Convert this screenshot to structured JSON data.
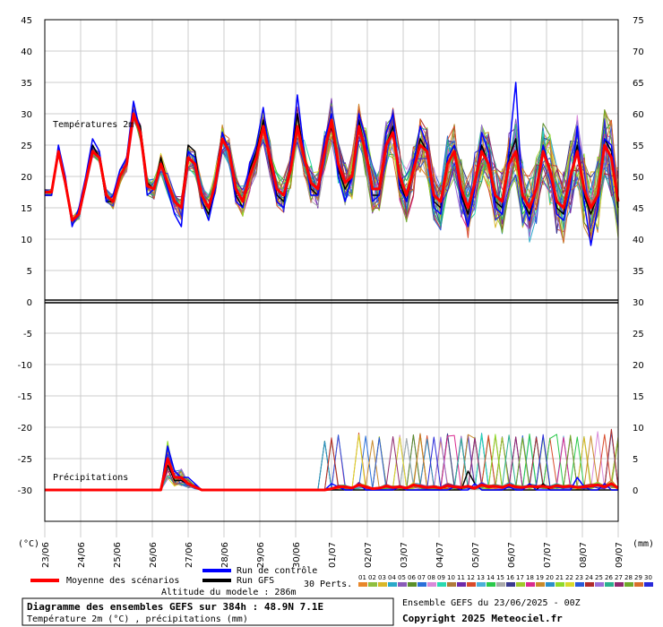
{
  "chart_data": {
    "type": "line",
    "title": "Diagramme des ensembles GEFS sur 384h : 48.9N 7.1E",
    "subtitle": "Température 2m (°C) , précipitations (mm)",
    "temp_label": "Températures 2m",
    "precip_label": "Précipitations",
    "left_unit": "(°C)",
    "right_unit": "(mm)",
    "left_ticks": [
      "45",
      "40",
      "35",
      "30",
      "25",
      "20",
      "15",
      "10",
      "5",
      "0",
      "-5",
      "-10",
      "-15",
      "-20",
      "-25",
      "-30"
    ],
    "right_ticks": [
      "75",
      "70",
      "65",
      "60",
      "55",
      "50",
      "45",
      "40",
      "35",
      "30",
      "25",
      "20",
      "15",
      "10",
      "5",
      "0"
    ],
    "x_dates": [
      "23/06",
      "24/06",
      "25/06",
      "26/06",
      "27/06",
      "28/06",
      "29/06",
      "30/06",
      "01/07",
      "02/07",
      "03/07",
      "04/07",
      "05/07",
      "06/07",
      "07/07",
      "08/07",
      "09/07"
    ],
    "temp_mean": [
      17.5,
      17.5,
      24,
      19,
      13,
      14,
      19,
      24,
      23,
      17,
      16,
      20,
      22,
      30,
      27,
      18.5,
      18,
      22,
      19,
      16,
      15,
      23,
      22,
      17,
      15,
      19,
      26,
      24,
      18,
      16,
      20,
      23,
      28,
      23,
      18,
      17,
      21,
      28,
      23,
      19,
      18,
      24,
      29,
      22,
      19,
      20,
      28,
      24,
      18,
      18,
      25,
      27,
      20,
      17,
      21,
      25,
      24,
      17,
      16,
      22,
      24,
      18,
      15,
      19,
      24,
      22,
      17,
      16,
      22,
      24,
      17,
      15,
      18,
      24,
      21,
      16,
      15,
      20,
      24,
      18,
      15,
      17,
      25,
      23,
      16
    ],
    "temp_control": [
      17,
      17,
      25,
      20,
      12,
      15,
      20,
      26,
      24,
      16,
      17,
      21,
      23,
      32,
      27,
      17,
      18,
      22,
      18,
      14,
      12,
      24,
      23,
      16,
      13,
      18,
      27,
      24,
      16,
      15,
      22,
      25,
      31,
      23,
      16,
      15,
      22,
      33,
      24,
      17,
      17,
      26,
      30,
      20,
      16,
      20,
      30,
      26,
      16,
      17,
      27,
      30,
      18,
      16,
      22,
      28,
      25,
      15,
      14,
      23,
      25,
      16,
      12,
      18,
      27,
      24,
      15,
      14,
      24,
      35,
      16,
      13,
      18,
      25,
      21,
      14,
      13,
      18,
      28,
      16,
      9,
      15,
      26,
      25,
      16
    ],
    "temp_gfs": [
      17,
      17,
      24,
      19,
      13,
      14,
      19,
      25,
      23,
      16,
      16,
      20,
      22,
      30,
      28,
      19,
      18,
      23,
      19,
      16,
      15,
      25,
      24,
      16,
      14,
      19,
      27,
      24,
      17,
      15,
      21,
      24,
      29,
      22,
      17,
      16,
      22,
      30,
      23,
      18,
      17,
      24,
      28,
      21,
      18,
      20,
      29,
      24,
      17,
      17,
      25,
      28,
      19,
      16,
      21,
      26,
      24,
      16,
      15,
      23,
      25,
      17,
      14,
      19,
      25,
      22,
      16,
      15,
      23,
      26,
      16,
      14,
      18,
      25,
      21,
      15,
      14,
      20,
      25,
      17,
      14,
      17,
      26,
      24,
      15
    ],
    "precip_mean": [
      0,
      0,
      0,
      0,
      0,
      0,
      0,
      0,
      0,
      0,
      0,
      0,
      0,
      0,
      0,
      0,
      0,
      0,
      5,
      2,
      2,
      1,
      0.5,
      0,
      0,
      0,
      0,
      0,
      0,
      0,
      0,
      0,
      0,
      0,
      0,
      0,
      0,
      0,
      0,
      0,
      0,
      0,
      0.2,
      0.5,
      0.5,
      0.3,
      0.8,
      0.5,
      0.2,
      0.3,
      0.6,
      0.4,
      0.5,
      0.3,
      0.8,
      0.6,
      0.4,
      0.5,
      0.3,
      0.7,
      0.5,
      0.4,
      0.6,
      0.3,
      0.8,
      0.5,
      0.6,
      0.4,
      0.8,
      0.5,
      0.4,
      0.6,
      0.5,
      0.6,
      0.4,
      0.7,
      0.5,
      0.6,
      0.4,
      0.5,
      0.6,
      0.8,
      0.5,
      1,
      0.3
    ],
    "precip_control": [
      0,
      0,
      0,
      0,
      0,
      0,
      0,
      0,
      0,
      0,
      0,
      0,
      0,
      0,
      0,
      0,
      0,
      0,
      7,
      3,
      2,
      2,
      1,
      0,
      0,
      0,
      0,
      0,
      0,
      0,
      0,
      0,
      0,
      0,
      0,
      0,
      0,
      0,
      0,
      0,
      0,
      0,
      1,
      0.5,
      0,
      0,
      1,
      0,
      0,
      0,
      0,
      0,
      0.5,
      0,
      0,
      0,
      0,
      0,
      0,
      0,
      0.5,
      0,
      0,
      1,
      0,
      0,
      0,
      0,
      0.5,
      0,
      0,
      1,
      0,
      0,
      0,
      0,
      0,
      0,
      2,
      0.5,
      0,
      0,
      1,
      0,
      0
    ],
    "precip_gfs": [
      0,
      0,
      0,
      0,
      0,
      0,
      0,
      0,
      0,
      0,
      0,
      0,
      0,
      0,
      0,
      0,
      0,
      0,
      4,
      1.5,
      1.5,
      1,
      0.5,
      0,
      0,
      0,
      0,
      0,
      0,
      0,
      0,
      0,
      0,
      0,
      0,
      0,
      0,
      0,
      0,
      0,
      0,
      0,
      0,
      0,
      0,
      0,
      0,
      0,
      0,
      0,
      0,
      0,
      0,
      0,
      0,
      0,
      0,
      0,
      0,
      0,
      0,
      0,
      3,
      1,
      0,
      0,
      0,
      0,
      0,
      0,
      0,
      0,
      0,
      1,
      0,
      0,
      0,
      0,
      0,
      0,
      0,
      0,
      0,
      0,
      0
    ],
    "temp_y_range": [
      -30,
      45
    ],
    "precip_y_range": [
      0,
      75
    ]
  },
  "legend": {
    "mean": "Moyenne des scénarios",
    "control": "Run de contrôle",
    "gfs": "Run GFS",
    "perts_label": "30 Perts.",
    "altitude": "Altitude du modele : 286m",
    "perts": [
      "01",
      "02",
      "03",
      "04",
      "05",
      "06",
      "07",
      "08",
      "09",
      "10",
      "11",
      "12",
      "13",
      "14",
      "15",
      "16",
      "17",
      "18",
      "19",
      "20",
      "21",
      "22",
      "23",
      "24",
      "25",
      "26",
      "27",
      "28",
      "29",
      "30"
    ],
    "pert_colors": [
      "#e8872a",
      "#8fbf3f",
      "#d9b82a",
      "#2aa9c9",
      "#8a5cb8",
      "#5a8f2a",
      "#2a6fd9",
      "#d98ad9",
      "#2ad9b0",
      "#b07a3a",
      "#6f2aa9",
      "#d94a2a",
      "#4ab0d9",
      "#2ac94a",
      "#a9a9a9",
      "#3a3a8f",
      "#9fc92a",
      "#d92a8f",
      "#c98a2a",
      "#2a8fc9",
      "#8fd92a",
      "#d9d92a",
      "#2a5ad9",
      "#b02a2a",
      "#9a6fd9",
      "#2ab08f",
      "#8f2a6f",
      "#6fa92a",
      "#d96f2a",
      "#2a2ad9"
    ],
    "mean_color": "#ff0000",
    "control_color": "#0000ff",
    "gfs_color": "#000000"
  },
  "footer": {
    "ensemble": "Ensemble GEFS du 23/06/2025 - 00Z",
    "copyright": "Copyright 2025 Meteociel.fr"
  }
}
